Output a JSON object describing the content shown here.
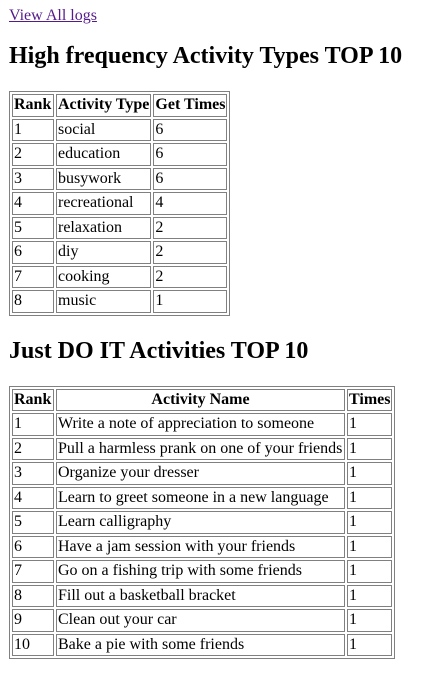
{
  "header": {
    "logs_link": "View All logs"
  },
  "activity_types": {
    "title": "High frequency Activity Types TOP 10",
    "columns": [
      "Rank",
      "Activity Type",
      "Get Times"
    ],
    "rows": [
      [
        "1",
        "social",
        "6"
      ],
      [
        "2",
        "education",
        "6"
      ],
      [
        "3",
        "busywork",
        "6"
      ],
      [
        "4",
        "recreational",
        "4"
      ],
      [
        "5",
        "relaxation",
        "2"
      ],
      [
        "6",
        "diy",
        "2"
      ],
      [
        "7",
        "cooking",
        "2"
      ],
      [
        "8",
        "music",
        "1"
      ]
    ]
  },
  "activities": {
    "title": "Just DO IT Activities TOP 10",
    "columns": [
      "Rank",
      "Activity Name",
      "Times"
    ],
    "rows": [
      [
        "1",
        "Write a note of appreciation to someone",
        "1"
      ],
      [
        "2",
        "Pull a harmless prank on one of your friends",
        "1"
      ],
      [
        "3",
        "Organize your dresser",
        "1"
      ],
      [
        "4",
        "Learn to greet someone in a new language",
        "1"
      ],
      [
        "5",
        "Learn calligraphy",
        "1"
      ],
      [
        "6",
        "Have a jam session with your friends",
        "1"
      ],
      [
        "7",
        "Go on a fishing trip with some friends",
        "1"
      ],
      [
        "8",
        "Fill out a basketball bracket",
        "1"
      ],
      [
        "9",
        "Clean out your car",
        "1"
      ],
      [
        "10",
        "Bake a pie with some friends",
        "1"
      ]
    ]
  },
  "colors": {
    "link": "#551a8b",
    "border": "#808080",
    "text": "#000000",
    "background": "#ffffff"
  }
}
